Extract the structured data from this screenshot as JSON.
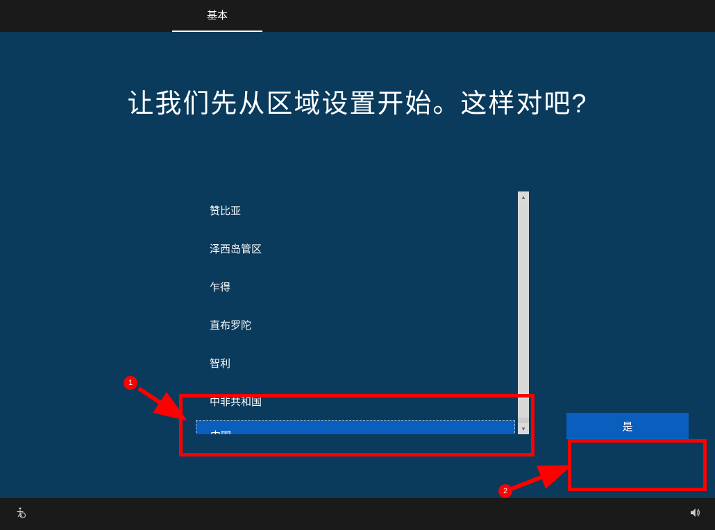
{
  "topbar": {
    "tab_label": "基本"
  },
  "heading": "让我们先从区域设置开始。这样对吧?",
  "region_list": {
    "items": [
      {
        "label": "赞比亚",
        "selected": false
      },
      {
        "label": "泽西岛管区",
        "selected": false
      },
      {
        "label": "乍得",
        "selected": false
      },
      {
        "label": "直布罗陀",
        "selected": false
      },
      {
        "label": "智利",
        "selected": false
      },
      {
        "label": "中非共和国",
        "selected": false
      },
      {
        "label": "中国",
        "selected": true
      }
    ]
  },
  "buttons": {
    "yes_label": "是"
  },
  "annotations": {
    "badge1": "1",
    "badge2": "2"
  }
}
